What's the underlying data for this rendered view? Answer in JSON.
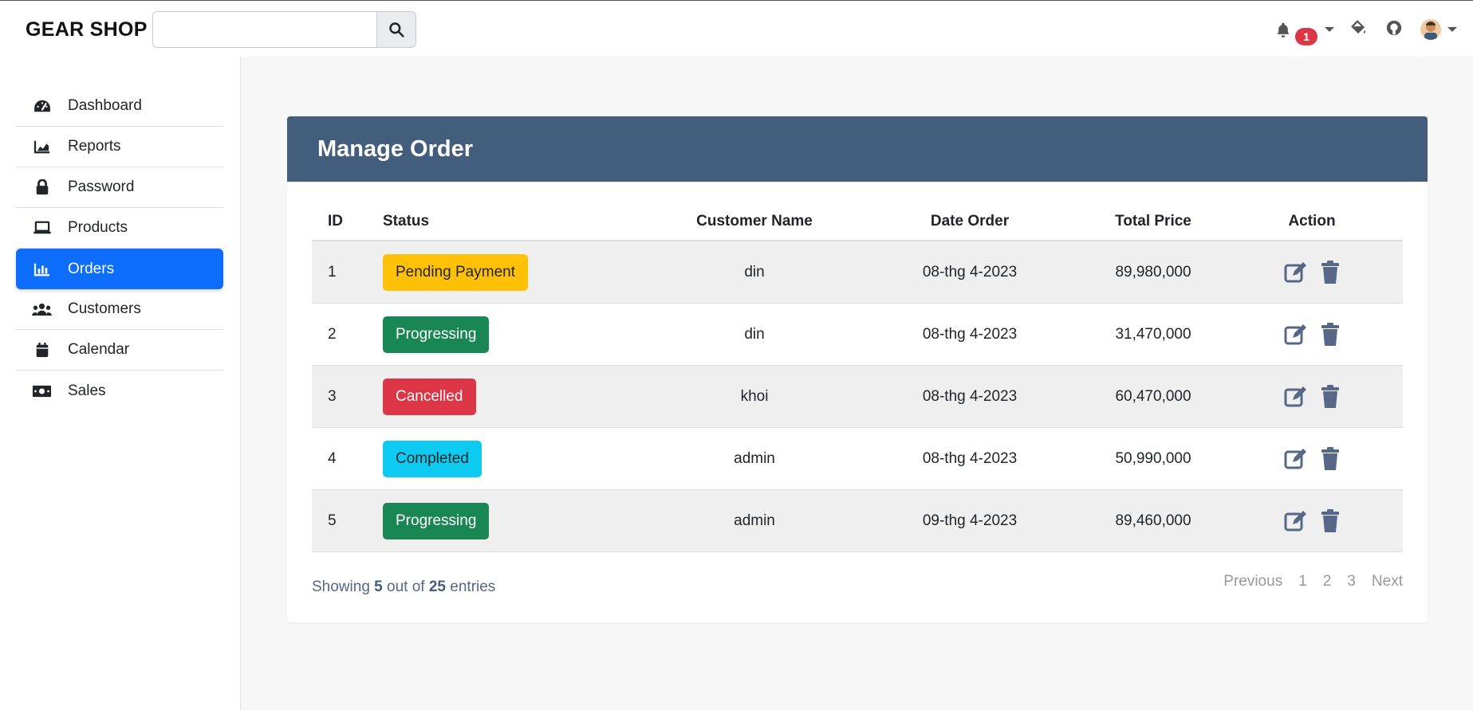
{
  "brand": "GEAR SHOP",
  "search": {
    "placeholder": "",
    "value": ""
  },
  "notifications": {
    "count": "1"
  },
  "sidebar": {
    "items": [
      {
        "label": "Dashboard",
        "icon": "gauge-icon"
      },
      {
        "label": "Reports",
        "icon": "chart-area-icon"
      },
      {
        "label": "Password",
        "icon": "lock-icon"
      },
      {
        "label": "Products",
        "icon": "laptop-icon"
      },
      {
        "label": "Orders",
        "icon": "chart-bar-icon",
        "active": true
      },
      {
        "label": "Customers",
        "icon": "users-icon"
      },
      {
        "label": "Calendar",
        "icon": "calendar-icon"
      },
      {
        "label": "Sales",
        "icon": "money-bill-icon"
      }
    ]
  },
  "card": {
    "title_prefix": "Manage",
    "title_bold": "Order"
  },
  "table": {
    "headers": {
      "id": "ID",
      "status": "Status",
      "customer": "Customer Name",
      "date": "Date Order",
      "total": "Total Price",
      "action": "Action"
    },
    "rows": [
      {
        "id": "1",
        "status": "Pending Payment",
        "customer": "din",
        "date": "08-thg 4-2023",
        "total": "89,980,000"
      },
      {
        "id": "2",
        "status": "Progressing",
        "customer": "din",
        "date": "08-thg 4-2023",
        "total": "31,470,000"
      },
      {
        "id": "3",
        "status": "Cancelled",
        "customer": "khoi",
        "date": "08-thg 4-2023",
        "total": "60,470,000"
      },
      {
        "id": "4",
        "status": "Completed",
        "customer": "admin",
        "date": "08-thg 4-2023",
        "total": "50,990,000"
      },
      {
        "id": "5",
        "status": "Progressing",
        "customer": "admin",
        "date": "09-thg 4-2023",
        "total": "89,460,000"
      }
    ]
  },
  "footer": {
    "showing": "Showing",
    "shown_count": "5",
    "out_of": "out of",
    "total_count": "25",
    "entries": "entries"
  },
  "pagination": {
    "previous": "Previous",
    "pages": [
      "1",
      "2",
      "3"
    ],
    "next": "Next"
  },
  "colors": {
    "header_bg": "#435d7d",
    "active_nav": "#0d6efd",
    "pending": "#ffc107",
    "progressing": "#198754",
    "cancelled": "#dc3545",
    "completed": "#0dcaf0"
  }
}
